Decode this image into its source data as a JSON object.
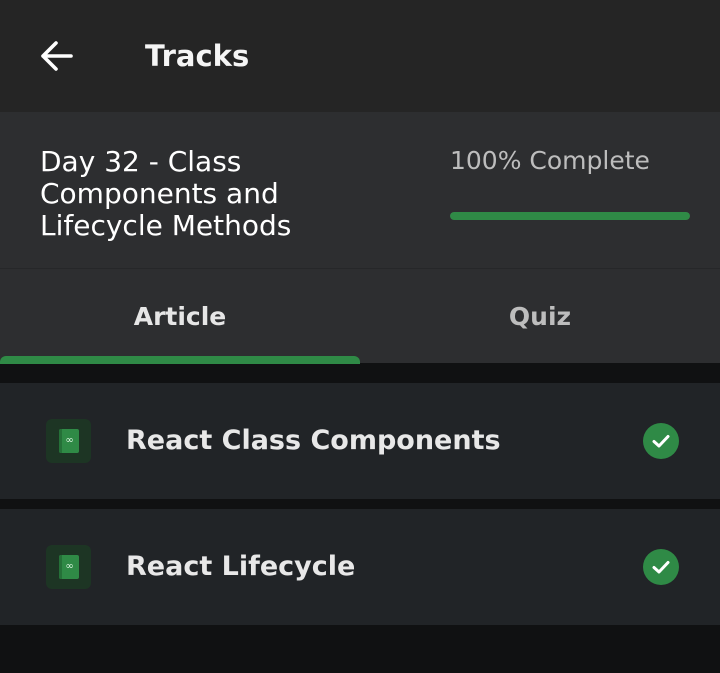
{
  "topbar": {
    "title": "Tracks",
    "back_icon": "arrow-left-icon"
  },
  "lesson": {
    "title": "Day 32 - Class Components and Lifecycle Methods",
    "progress_label": "100% Complete",
    "progress_percent": 100
  },
  "tabs": [
    {
      "label": "Article",
      "active": true
    },
    {
      "label": "Quiz",
      "active": false
    }
  ],
  "items": [
    {
      "label": "React Class Components",
      "icon": "book-icon",
      "status_icon": "check-circle-icon"
    },
    {
      "label": "React Lifecycle",
      "icon": "book-icon",
      "status_icon": "check-circle-icon"
    }
  ],
  "colors": {
    "accent": "#2f8a46",
    "topbar_bg": "#252525",
    "header_bg": "#2d2e30",
    "item_bg": "#212427",
    "page_bg": "#101112"
  }
}
